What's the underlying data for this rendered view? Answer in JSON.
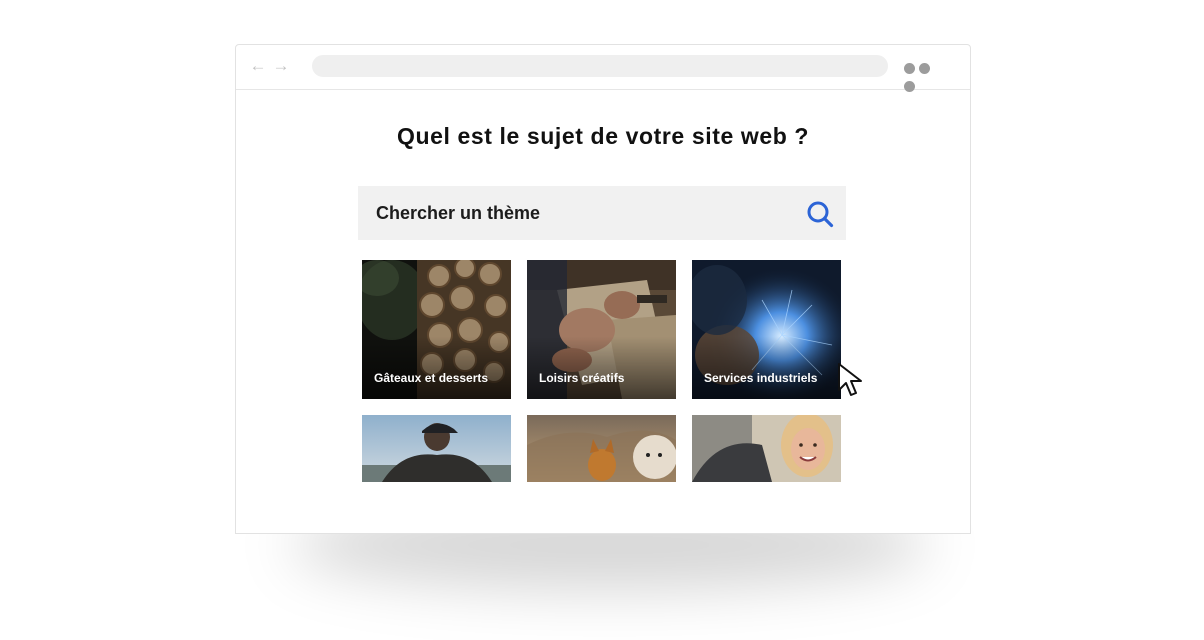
{
  "browser": {
    "back_icon": "arrow-left-icon",
    "forward_icon": "arrow-right-icon",
    "menu_icon": "more-dots-icon"
  },
  "page": {
    "title": "Quel est le sujet de votre site web ?"
  },
  "search": {
    "placeholder": "Chercher un thème",
    "icon": "search-icon",
    "icon_color": "#2c64d6"
  },
  "themes": [
    {
      "label": "Gâteaux et desserts"
    },
    {
      "label": "Loisirs créatifs"
    },
    {
      "label": "Services industriels"
    },
    {
      "label": ""
    },
    {
      "label": ""
    },
    {
      "label": ""
    }
  ],
  "colors": {
    "accent": "#2c64d6",
    "search_bg": "#f1f1f1"
  }
}
